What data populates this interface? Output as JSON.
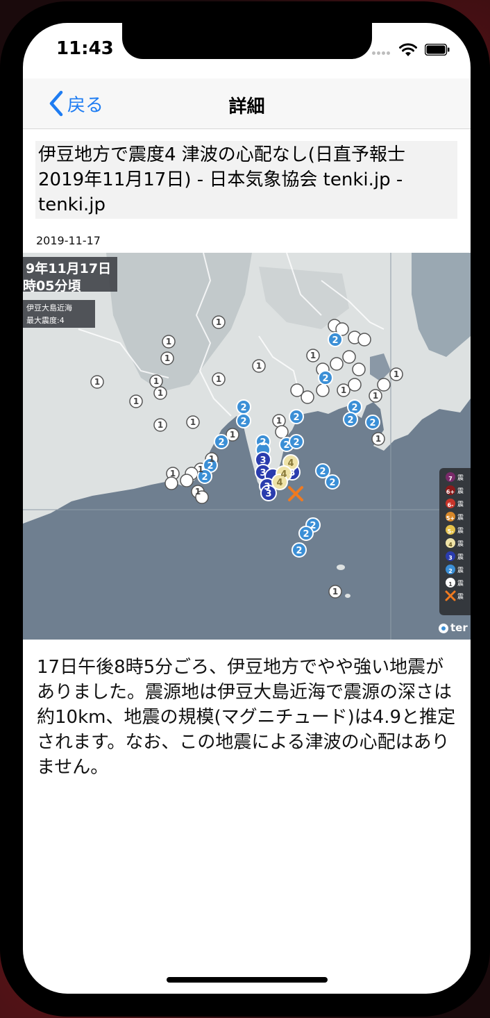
{
  "status_bar": {
    "time": "11:43"
  },
  "navbar": {
    "back_label": "戻る",
    "title": "詳細"
  },
  "article": {
    "title": "伊豆地方で震度4 津波の心配なし(日直予報士 2019年11月17日) - 日本気象協会 tenki.jp - tenki.jp",
    "date": "2019-11-17",
    "body": "17日午後8時5分ごろ、伊豆地方でやや強い地震がありました。震源地は伊豆大島近海で震源の深さは約10km、地震の規模(マグニチュード)は4.9と推定されます。なお、この地震による津波の心配はありません。"
  },
  "map": {
    "date_line1": "9年11月17日",
    "date_line2": "時05分頃",
    "epicenter_line": "伊豆大島近海",
    "max_intensity_line": "最大震度:4",
    "legend": [
      "7",
      "6+",
      "6-",
      "5+",
      "5-",
      "4",
      "3",
      "2",
      "1"
    ],
    "legend_suffix": "震",
    "brand": "ter",
    "colors": {
      "land": "#dfe3e3",
      "sea": "#6f7f90",
      "int1": "#ffffff",
      "int2": "#3b8fd6",
      "int3": "#2a3cae",
      "int4": "#efe3a8",
      "epicenter": "#f07a20"
    }
  }
}
